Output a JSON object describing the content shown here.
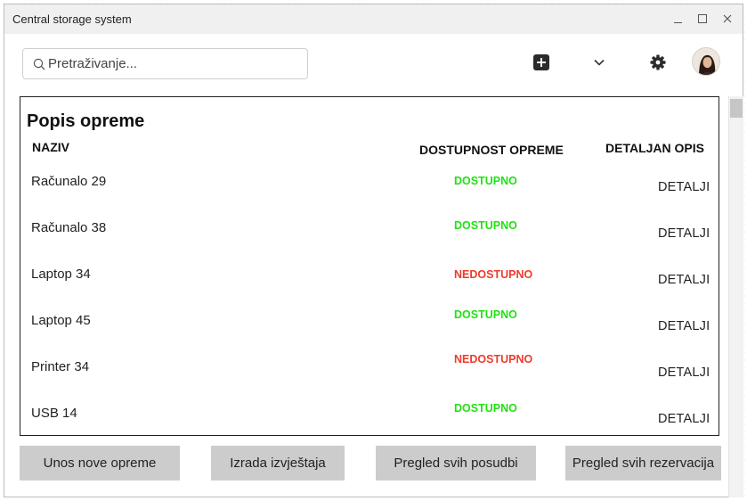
{
  "window": {
    "title": "Central storage system",
    "controls": {
      "minimize": "_",
      "maximize": "☐",
      "close": "✕"
    }
  },
  "toolbar": {
    "search_placeholder": "Pretraživanje...",
    "icons": [
      "search-icon",
      "add-icon",
      "chevron-down-icon",
      "gear-icon",
      "avatar"
    ]
  },
  "panel": {
    "title": "Popis opreme",
    "headers": {
      "naziv": "NAZIV",
      "dostupnost": "DOSTUPNOST OPREME",
      "opis": "DETALJAN OPIS"
    },
    "rows": [
      {
        "name": "Računalo 29",
        "status": "DOSTUPNO",
        "available": true,
        "link": "DETALJI"
      },
      {
        "name": "Računalo 38",
        "status": "DOSTUPNO",
        "available": true,
        "link": "DETALJI"
      },
      {
        "name": "Laptop 34",
        "status": "NEDOSTUPNO",
        "available": false,
        "link": "DETALJI"
      },
      {
        "name": "Laptop 45",
        "status": "DOSTUPNO",
        "available": true,
        "link": "DETALJI"
      },
      {
        "name": "Printer 34",
        "status": "NEDOSTUPNO",
        "available": false,
        "link": "DETALJI"
      },
      {
        "name": "USB 14",
        "status": "DOSTUPNO",
        "available": true,
        "link": "DETALJI"
      }
    ]
  },
  "colors": {
    "available": "#22e014",
    "unavailable": "#ee3b2c",
    "button_bg": "#cccccc"
  },
  "footer": {
    "buttons": [
      "Unos nove opreme",
      "Izrada izvještaja",
      "Pregled svih posudbi",
      "Pregled svih rezervacija"
    ]
  }
}
